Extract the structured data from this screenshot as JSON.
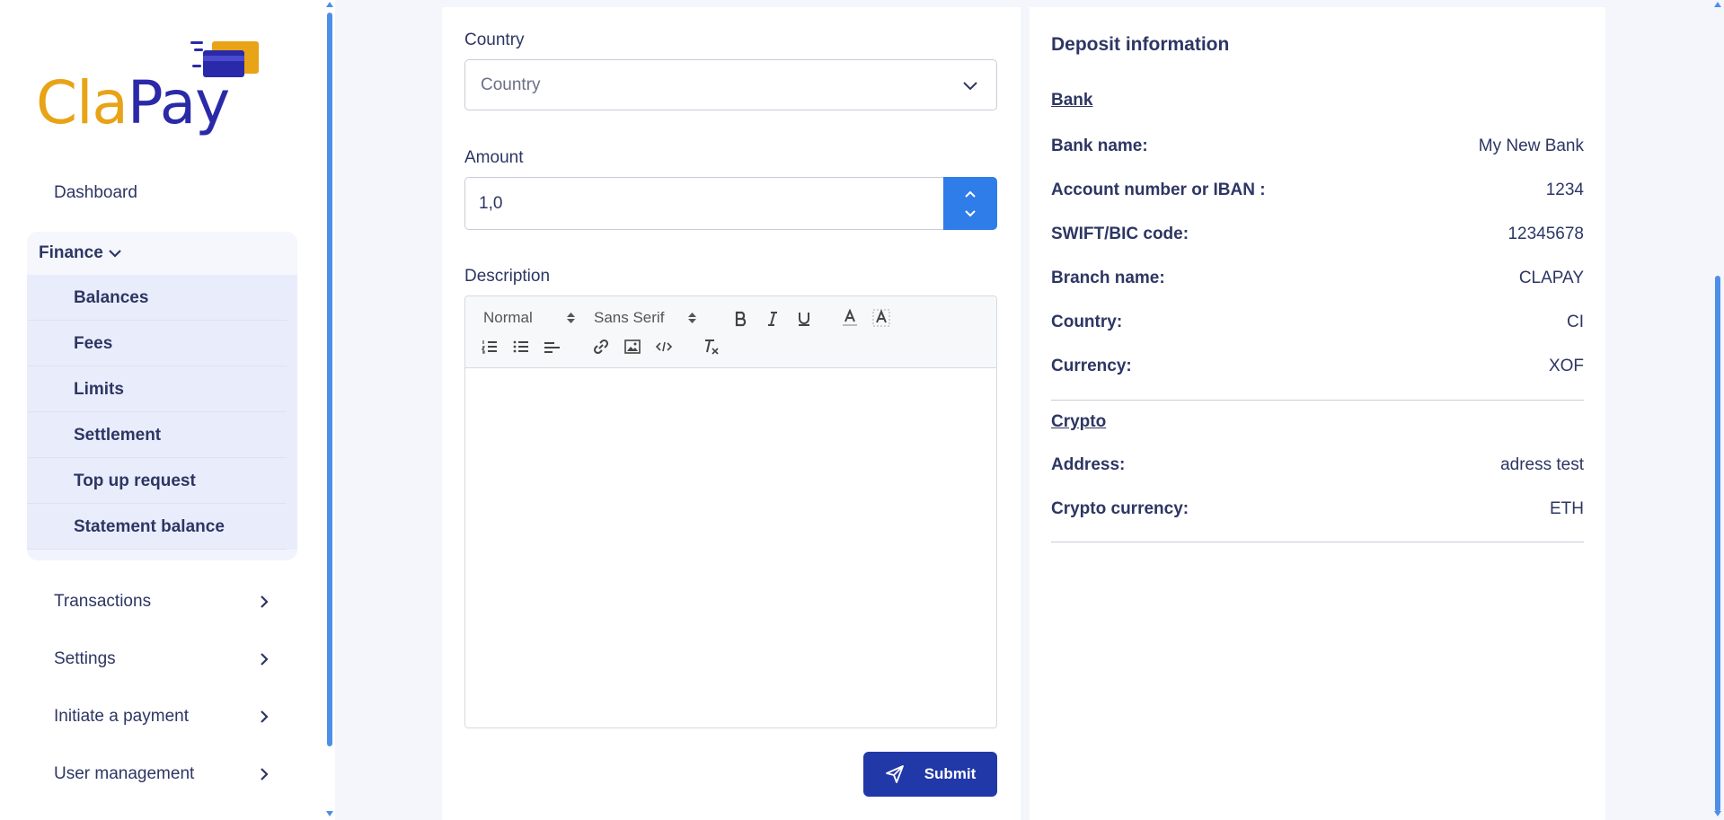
{
  "brand": {
    "name_part1": "Cla",
    "name_part2": "Pay"
  },
  "sidebar": {
    "dashboard": "Dashboard",
    "finance": {
      "label": "Finance",
      "items": [
        "Balances",
        "Fees",
        "Limits",
        "Settlement",
        "Top up request",
        "Statement balance"
      ]
    },
    "collapsed": [
      "Transactions",
      "Settings",
      "Initiate a payment",
      "User management"
    ]
  },
  "form": {
    "country_label": "Country",
    "country_placeholder": "Country",
    "amount_label": "Amount",
    "amount_value": "1,0",
    "description_label": "Description",
    "editor": {
      "format": "Normal",
      "font": "Sans Serif"
    },
    "submit_label": "Submit"
  },
  "deposit": {
    "title": "Deposit information",
    "bank_section": "Bank",
    "bank_rows": [
      {
        "k": "Bank name:",
        "v": "My New Bank"
      },
      {
        "k": "Account number or IBAN :",
        "v": "1234"
      },
      {
        "k": "SWIFT/BIC code:",
        "v": "12345678"
      },
      {
        "k": "Branch name:",
        "v": "CLAPAY"
      },
      {
        "k": "Country:",
        "v": "CI"
      },
      {
        "k": "Currency:",
        "v": "XOF"
      }
    ],
    "crypto_section": "Crypto",
    "crypto_rows": [
      {
        "k": "Address:",
        "v": "adress test"
      },
      {
        "k": "Crypto currency:",
        "v": "ETH"
      }
    ]
  },
  "colors": {
    "brand_orange": "#e8a317",
    "brand_blue": "#2a2aa8",
    "primary": "#2138a8",
    "accent": "#2f7de8"
  }
}
